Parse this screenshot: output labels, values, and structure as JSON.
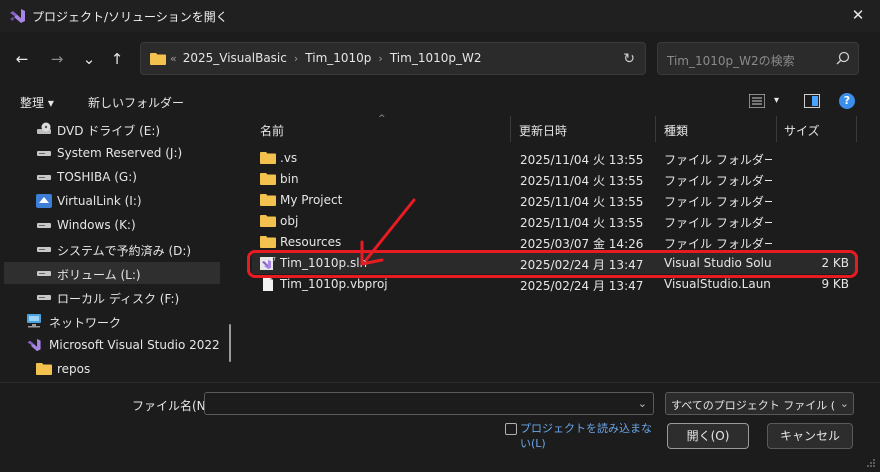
{
  "window": {
    "title": "プロジェクト/ソリューションを開く",
    "close_glyph": "✕"
  },
  "nav": {
    "back_glyph": "←",
    "forward_glyph": "→",
    "recent_glyph": "⌄",
    "up_glyph": "↑",
    "breadcrumb_overflow": "«",
    "breadcrumbs": [
      "2025_VisualBasic",
      "Tim_1010p",
      "Tim_1010p_W2"
    ],
    "breadcrumb_sep": "›",
    "refresh_glyph": "↻",
    "search_placeholder": "Tim_1010p_W2の検索"
  },
  "toolbar": {
    "organize_label": "整理 ▾",
    "new_folder_label": "新しいフォルダー",
    "view_dropdown_glyph": "▾",
    "help_glyph": "?"
  },
  "sidebar": {
    "items": [
      {
        "label": "DVD ドライブ (E:)",
        "icon": "dvd-drive-icon"
      },
      {
        "label": "System Reserved (J:)",
        "icon": "drive-icon"
      },
      {
        "label": "TOSHIBA (G:)",
        "icon": "drive-icon"
      },
      {
        "label": "VirtualLink (I:)",
        "icon": "virtual-drive-icon"
      },
      {
        "label": "Windows (K:)",
        "icon": "drive-icon"
      },
      {
        "label": "システムで予約済み (D:)",
        "icon": "drive-icon"
      },
      {
        "label": "ボリューム (L:)",
        "icon": "drive-icon"
      },
      {
        "label": "ローカル ディスク (F:)",
        "icon": "drive-icon"
      },
      {
        "label": "ネットワーク",
        "icon": "network-icon"
      },
      {
        "label": "Microsoft Visual Studio 2022",
        "icon": "visual-studio-icon"
      },
      {
        "label": "repos",
        "icon": "folder-icon"
      }
    ]
  },
  "files": {
    "columns": {
      "name": "名前",
      "date": "更新日時",
      "type": "種類",
      "size": "サイズ"
    },
    "sort_glyph": "^",
    "rows": [
      {
        "name": ".vs",
        "date": "2025/11/04 火 13:55",
        "type": "ファイル フォルダー",
        "size": "",
        "icon": "folder-icon"
      },
      {
        "name": "bin",
        "date": "2025/11/04 火 13:55",
        "type": "ファイル フォルダー",
        "size": "",
        "icon": "folder-icon"
      },
      {
        "name": "My Project",
        "date": "2025/11/04 火 13:55",
        "type": "ファイル フォルダー",
        "size": "",
        "icon": "folder-icon"
      },
      {
        "name": "obj",
        "date": "2025/11/04 火 13:55",
        "type": "ファイル フォルダー",
        "size": "",
        "icon": "folder-icon"
      },
      {
        "name": "Resources",
        "date": "2025/03/07 金 14:26",
        "type": "ファイル フォルダー",
        "size": "",
        "icon": "folder-icon"
      },
      {
        "name": "Tim_1010p.sln",
        "date": "2025/02/24 月 13:47",
        "type": "Visual Studio Solu...",
        "size": "2 KB",
        "icon": "solution-file-icon"
      },
      {
        "name": "Tim_1010p.vbproj",
        "date": "2025/02/24 月 13:47",
        "type": "VisualStudio.Laun...",
        "size": "9 KB",
        "icon": "document-icon"
      }
    ]
  },
  "footer": {
    "filename_label": "ファイル名(N):",
    "filename_value": "",
    "dropdown_glyph": "⌄",
    "filter_value": "すべてのプロジェクト ファイル (*.sln;*",
    "checkbox_label": "プロジェクトを読み込まない(L)",
    "open_label": "開く(O)",
    "cancel_label": "キャンセル"
  },
  "colors": {
    "accent_red": "#e81b23",
    "folder_yellow": "#f2c14e",
    "vs_purple": "#8661c5",
    "link_blue": "#6aa6e8"
  }
}
